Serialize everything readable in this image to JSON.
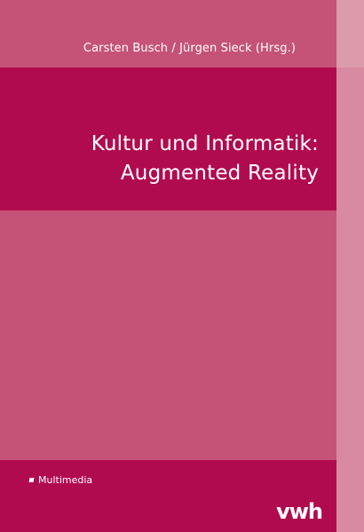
{
  "cover": {
    "authors": "Carsten Busch / Jürgen Sieck (Hrsg.)",
    "title_line1": "Kultur und Informatik:",
    "title_line2": "Augmented Reality",
    "series_label": "Multimedia",
    "publisher_logo": "vwh"
  },
  "colors": {
    "primary_magenta": "#b10b4f",
    "light_magenta": "#c55377",
    "strip_pink": "#d88aa0"
  },
  "icons": {
    "series_bullet": "square-bullet-icon"
  }
}
